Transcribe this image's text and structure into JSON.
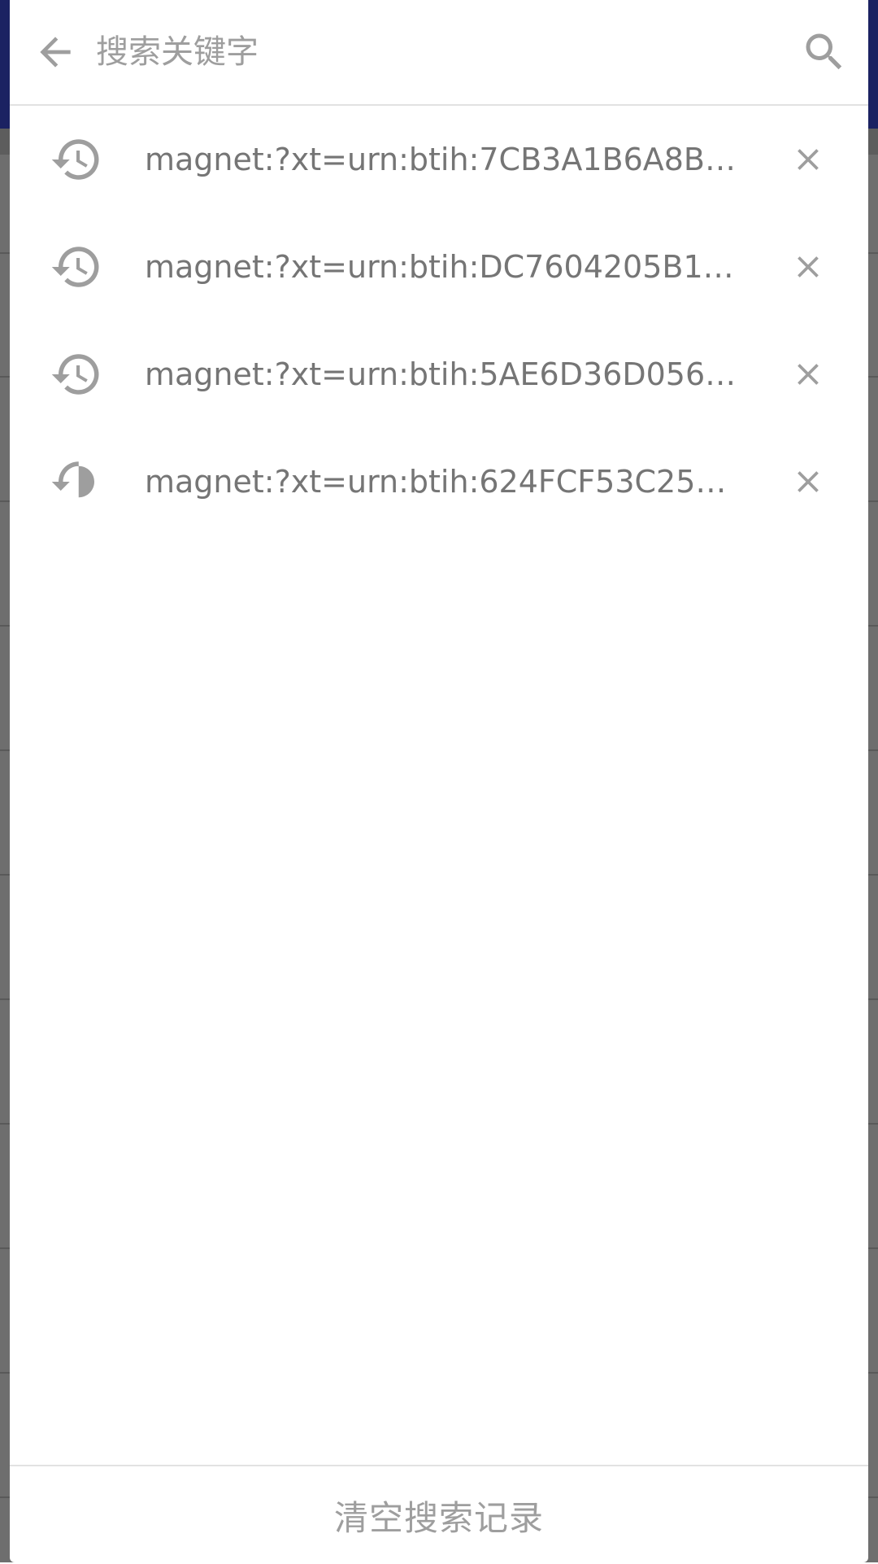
{
  "search": {
    "placeholder": "搜索关键字",
    "value": ""
  },
  "icons": {
    "back": "arrow-back-icon",
    "search": "search-icon",
    "history": "history-icon",
    "remove": "close-icon"
  },
  "colors": {
    "icon_gray": "#9e9e9e",
    "text_gray": "#757575",
    "background_appbar": "#1b2262",
    "divider": "#e2e2e2"
  },
  "history": [
    {
      "text": "magnet:?xt=urn:btih:7CB3A1B6A8B8..."
    },
    {
      "text": "magnet:?xt=urn:btih:DC7604205B10..."
    },
    {
      "text": "magnet:?xt=urn:btih:5AE6D36D0562..."
    },
    {
      "text": "magnet:?xt=urn:btih:624FCF53C256..."
    }
  ],
  "footer": {
    "clear_label": "清空搜索记录"
  }
}
